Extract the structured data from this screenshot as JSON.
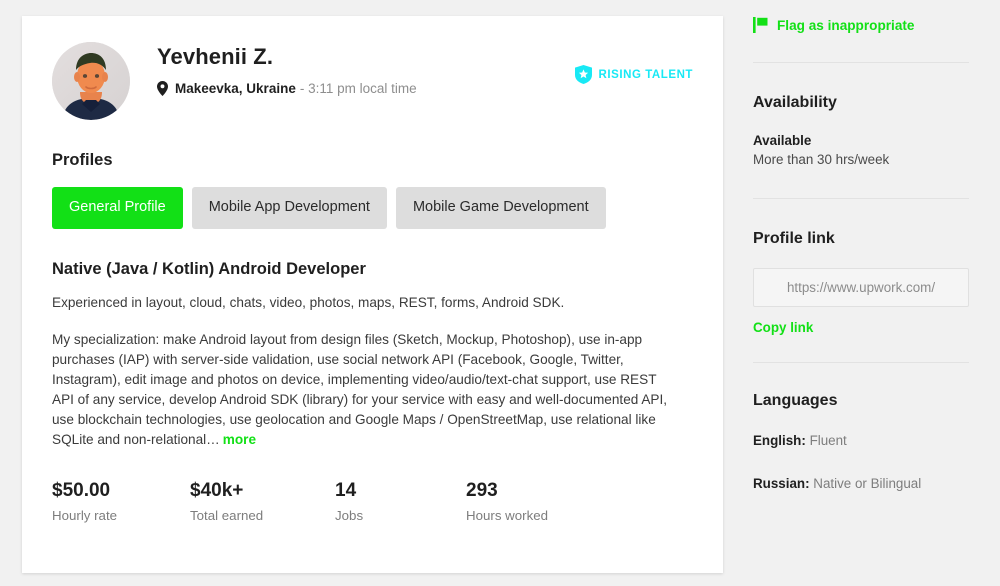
{
  "profile": {
    "name": "Yevhenii Z.",
    "location": "Makeevka, Ukraine",
    "local_time": "- 3:11 pm local time",
    "badge": "RISING TALENT",
    "badge_color": "#18e9f5",
    "avatar_icon": "user-photo"
  },
  "profiles_section": {
    "heading": "Profiles",
    "tabs": [
      {
        "label": "General Profile",
        "active": true
      },
      {
        "label": "Mobile App Development",
        "active": false
      },
      {
        "label": "Mobile Game Development",
        "active": false
      }
    ],
    "active_color": "#12e016"
  },
  "overview": {
    "title": "Native (Java / Kotlin) Android Developer",
    "intro": "Experienced in layout, cloud, chats, video, photos, maps, REST, forms, Android SDK.",
    "body": "My specialization: make Android layout from design files (Sketch, Mockup, Photoshop), use in-app purchases (IAP) with server-side validation, use social network API (Facebook, Google, Twitter, Instagram), edit image and photos on device, implementing video/audio/text-chat support, use REST API of any service, develop Android SDK (library) for your service with easy and well-documented API, use blockchain technologies, use geolocation and Google Maps / OpenStreetMap, use relational like SQLite and non-relational…",
    "more_label": "more"
  },
  "stats": [
    {
      "value": "$50.00",
      "label": "Hourly rate"
    },
    {
      "value": "$40k+",
      "label": "Total earned"
    },
    {
      "value": "14",
      "label": "Jobs"
    },
    {
      "value": "293",
      "label": "Hours worked"
    }
  ],
  "sidebar": {
    "flag": {
      "label": "Flag as inappropriate",
      "icon": "flag-icon",
      "color": "#12e016"
    },
    "availability": {
      "heading": "Availability",
      "state": "Available",
      "detail": "More than 30 hrs/week"
    },
    "profile_link": {
      "heading": "Profile link",
      "value": "https://www.upwork.com/",
      "placeholder": "https://www.upwork.com/",
      "copy_label": "Copy link"
    },
    "languages": {
      "heading": "Languages",
      "items": [
        {
          "name": "English:",
          "level": "Fluent"
        },
        {
          "name": "Russian:",
          "level": "Native or Bilingual"
        }
      ]
    }
  }
}
